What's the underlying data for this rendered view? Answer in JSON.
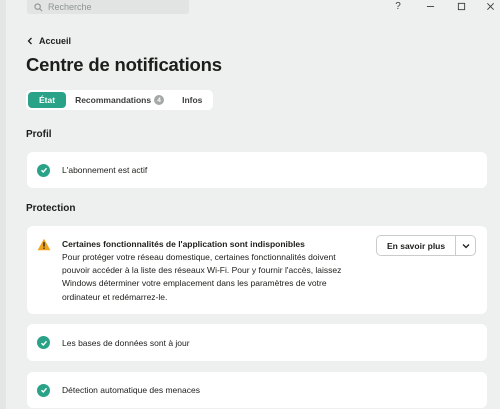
{
  "search": {
    "placeholder": "Recherche"
  },
  "window_controls": {
    "help": "?",
    "minimize": "–",
    "maximize": "▢",
    "close": "✕"
  },
  "header": {
    "back_label": "Accueil",
    "title": "Centre de notifications"
  },
  "tabs": [
    {
      "label": "État",
      "active": true
    },
    {
      "label": "Recommandations",
      "badge": "4"
    },
    {
      "label": "Infos"
    }
  ],
  "profile": {
    "title": "Profil",
    "items": [
      {
        "text": "L'abonnement est actif",
        "status": "ok"
      }
    ]
  },
  "protection": {
    "title": "Protection",
    "warning": {
      "title": "Certaines fonctionnalités de l'application sont indisponibles",
      "body_lines": [
        "Pour protéger votre réseau domestique, certaines fonctionnalités doivent",
        "pouvoir accéder à la liste des réseaux Wi-Fi. Pour y fournir l'accès, laissez",
        "Windows déterminer votre emplacement dans les paramètres de votre",
        "ordinateur et redémarrez-le."
      ],
      "button_label": "En savoir plus"
    },
    "items": [
      {
        "text": "Les bases de données sont à jour",
        "status": "ok"
      },
      {
        "text": "Détection automatique des menaces",
        "status": "ok"
      }
    ]
  },
  "colors": {
    "accent": "#2aa287",
    "warning": "#f0a31c",
    "background": "#eef0ef"
  }
}
